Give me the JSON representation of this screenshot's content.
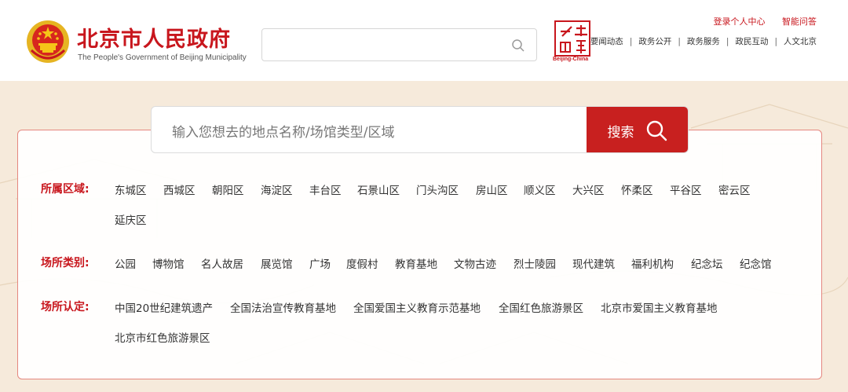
{
  "header": {
    "title": "北京市人民政府",
    "subtitle": "The People's Government of Beijing Municipality",
    "capital_logo_text": "Beijing-China",
    "top_links": [
      "登录个人中心",
      "智能问答"
    ],
    "nav": [
      "要闻动态",
      "政务公开",
      "政务服务",
      "政民互动",
      "人文北京"
    ]
  },
  "search": {
    "placeholder": "输入您想去的地点名称/场馆类型/区域",
    "button_label": "搜索"
  },
  "filters": {
    "district": {
      "label": "所属区域:",
      "items": [
        "东城区",
        "西城区",
        "朝阳区",
        "海淀区",
        "丰台区",
        "石景山区",
        "门头沟区",
        "房山区",
        "顺义区",
        "大兴区",
        "怀柔区",
        "平谷区",
        "密云区",
        "延庆区"
      ]
    },
    "category": {
      "label": "场所类别:",
      "items": [
        "公园",
        "博物馆",
        "名人故居",
        "展览馆",
        "广场",
        "度假村",
        "教育基地",
        "文物古迹",
        "烈士陵园",
        "现代建筑",
        "福利机构",
        "纪念坛",
        "纪念馆"
      ]
    },
    "certification": {
      "label": "场所认定:",
      "items": [
        "中国20世纪建筑遗产",
        "全国法治宣传教育基地",
        "全国爱国主义教育示范基地",
        "全国红色旅游景区",
        "北京市爱国主义教育基地",
        "北京市红色旅游景区"
      ]
    }
  },
  "colors": {
    "brand_red": "#c8161d",
    "button_red": "#c8201f",
    "panel_border": "#e5877f",
    "page_bg": "#f6eadb"
  }
}
